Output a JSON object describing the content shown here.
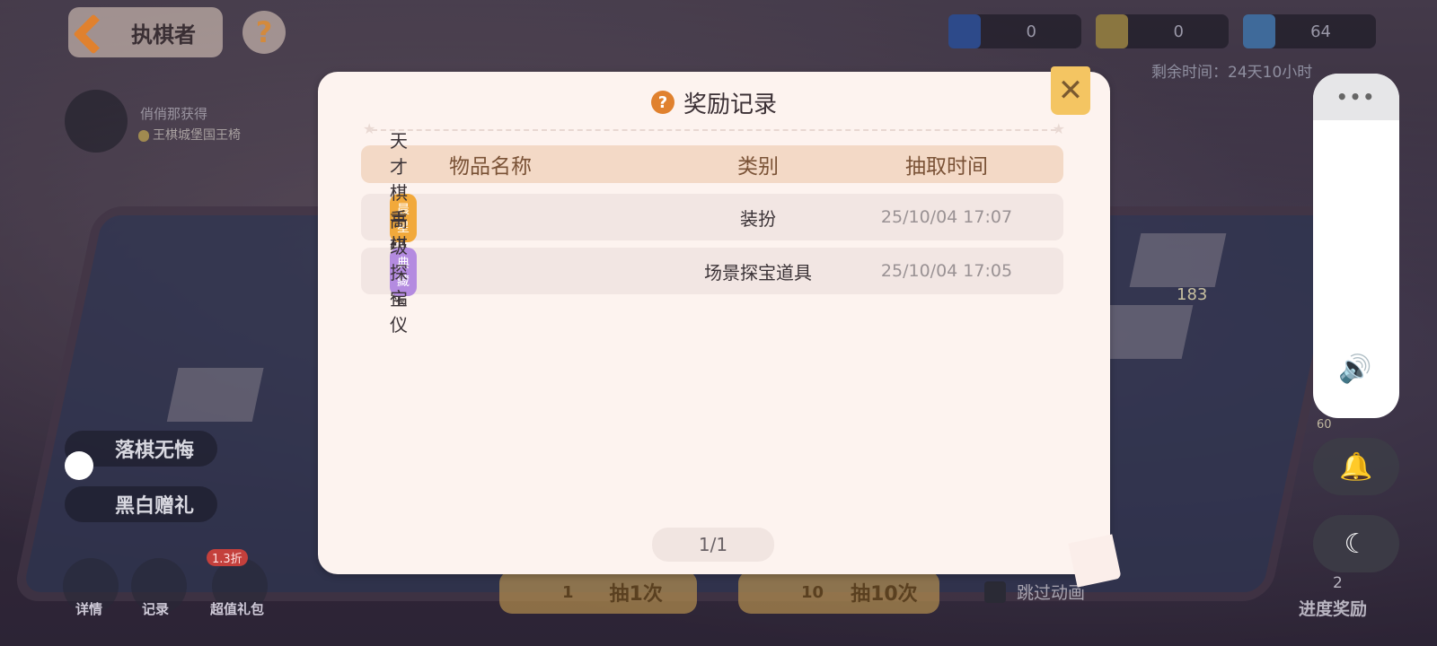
{
  "header": {
    "role_button_label": "执棋者",
    "help_symbol": "?"
  },
  "left_panel": {
    "obtained_label": "俏俏那获得",
    "obtained_tag": "",
    "obtained_value": "王棋城堡国王椅",
    "tag_1": "落棋无悔",
    "tag_2": "黑白赠礼"
  },
  "resources": [
    {
      "icon": "chess-piece-icon",
      "value": "0"
    },
    {
      "icon": "crown-piece-icon",
      "value": "0"
    },
    {
      "icon": "gem-icon",
      "value": "64"
    }
  ],
  "remaining_time": "剩余时间：24天10小时",
  "board": {
    "gift_count": "183",
    "side_count": "60"
  },
  "bottom_bar": {
    "details_label": "详情",
    "record_label": "记录",
    "gift_pack_label": "超值礼包",
    "gift_pack_badge": "1.3折",
    "draw1_count": "1",
    "draw1_label": "抽1次",
    "draw10_count": "10",
    "draw10_label": "抽10次",
    "skip_label": "跳过动画",
    "progress_count": "2",
    "progress_label": "进度奖励"
  },
  "system_panel": {
    "more": "•••",
    "volume_icon": "speaker-icon",
    "bell_icon": "bell-icon",
    "moon_icon": "moon-icon"
  },
  "modal": {
    "title": "奖励记录",
    "close_symbol": "✕",
    "columns": [
      "物品名称",
      "类别",
      "抽取时间"
    ],
    "rows": [
      {
        "rarity": "晨星",
        "rarity_color": "#f2a93b",
        "name": "天才棋手棋盘裙",
        "category": "装扮",
        "time": "25/10/04 17:07"
      },
      {
        "rarity": "典藏",
        "rarity_color": "#b48be0",
        "name": "高级探宝仪",
        "category": "场景探宝道具",
        "time": "25/10/04 17:05"
      }
    ],
    "pager": "1/1"
  }
}
